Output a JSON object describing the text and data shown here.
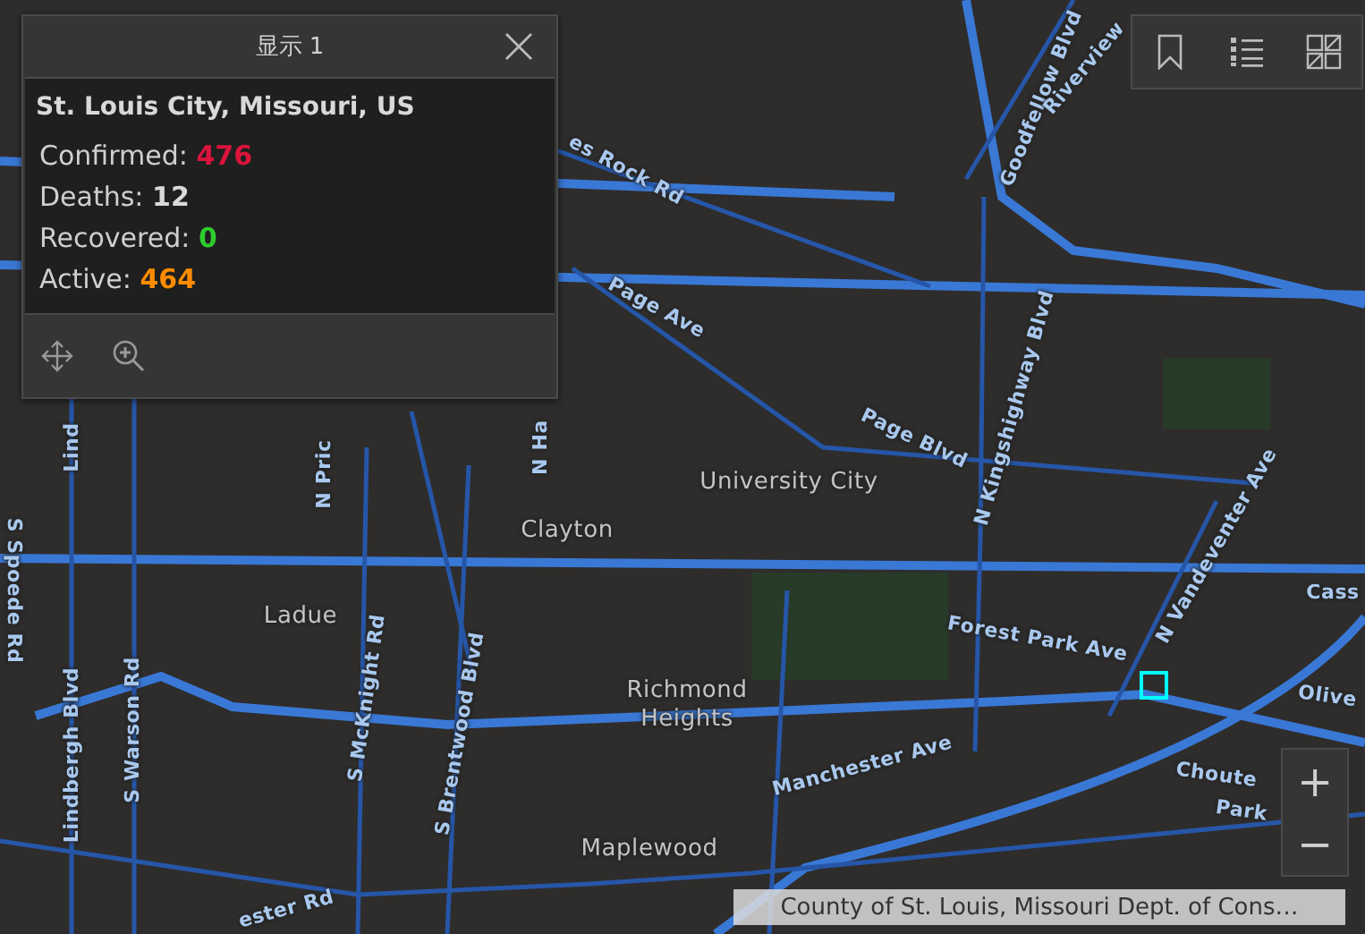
{
  "map": {
    "labels": [
      {
        "text": "University City",
        "kind": "place"
      },
      {
        "text": "Clayton",
        "kind": "place"
      },
      {
        "text": "Ladue",
        "kind": "place"
      },
      {
        "text": "Richmond Heights",
        "kind": "place"
      },
      {
        "text": "Maplewood",
        "kind": "place"
      },
      {
        "text": "Page Ave",
        "kind": "street"
      },
      {
        "text": "Page Blvd",
        "kind": "street"
      },
      {
        "text": "es Rock Rd",
        "kind": "street"
      },
      {
        "text": "Forest Park Ave",
        "kind": "street"
      },
      {
        "text": "Manchester Ave",
        "kind": "street"
      },
      {
        "text": "Choute",
        "kind": "street"
      },
      {
        "text": "Park",
        "kind": "street"
      },
      {
        "text": "Olive",
        "kind": "street"
      },
      {
        "text": "Cass",
        "kind": "street"
      },
      {
        "text": "N Kingshighway Blvd",
        "kind": "street"
      },
      {
        "text": "N Vandeventer Ave",
        "kind": "street"
      },
      {
        "text": "Goodfellow Blvd",
        "kind": "street"
      },
      {
        "text": "Riverview",
        "kind": "street"
      },
      {
        "text": "Lindbergh Blvd",
        "kind": "street"
      },
      {
        "text": "S Warson Rd",
        "kind": "street"
      },
      {
        "text": "S McKnight Rd",
        "kind": "street"
      },
      {
        "text": "S Brentwood Blvd",
        "kind": "street"
      },
      {
        "text": "S Spoede Rd",
        "kind": "street"
      },
      {
        "text": "N Pric",
        "kind": "street"
      },
      {
        "text": "N Ha",
        "kind": "street"
      },
      {
        "text": "Lind",
        "kind": "street"
      },
      {
        "text": "ester Rd",
        "kind": "street"
      }
    ]
  },
  "popup": {
    "title": "显示 1",
    "heading": "St. Louis City, Missouri, US",
    "fields": [
      {
        "label": "Confirmed:",
        "value": "476",
        "color": "#dc143c"
      },
      {
        "label": "Deaths:",
        "value": "12",
        "color": "#d9d9d9"
      },
      {
        "label": "Recovered:",
        "value": "0",
        "color": "#2ecc2e"
      },
      {
        "label": "Active:",
        "value": "464",
        "color": "#ff8c00"
      }
    ]
  },
  "zoom": {
    "in": "+",
    "out": "−"
  },
  "attribution": "County of St. Louis, Missouri Dept. of Cons…"
}
